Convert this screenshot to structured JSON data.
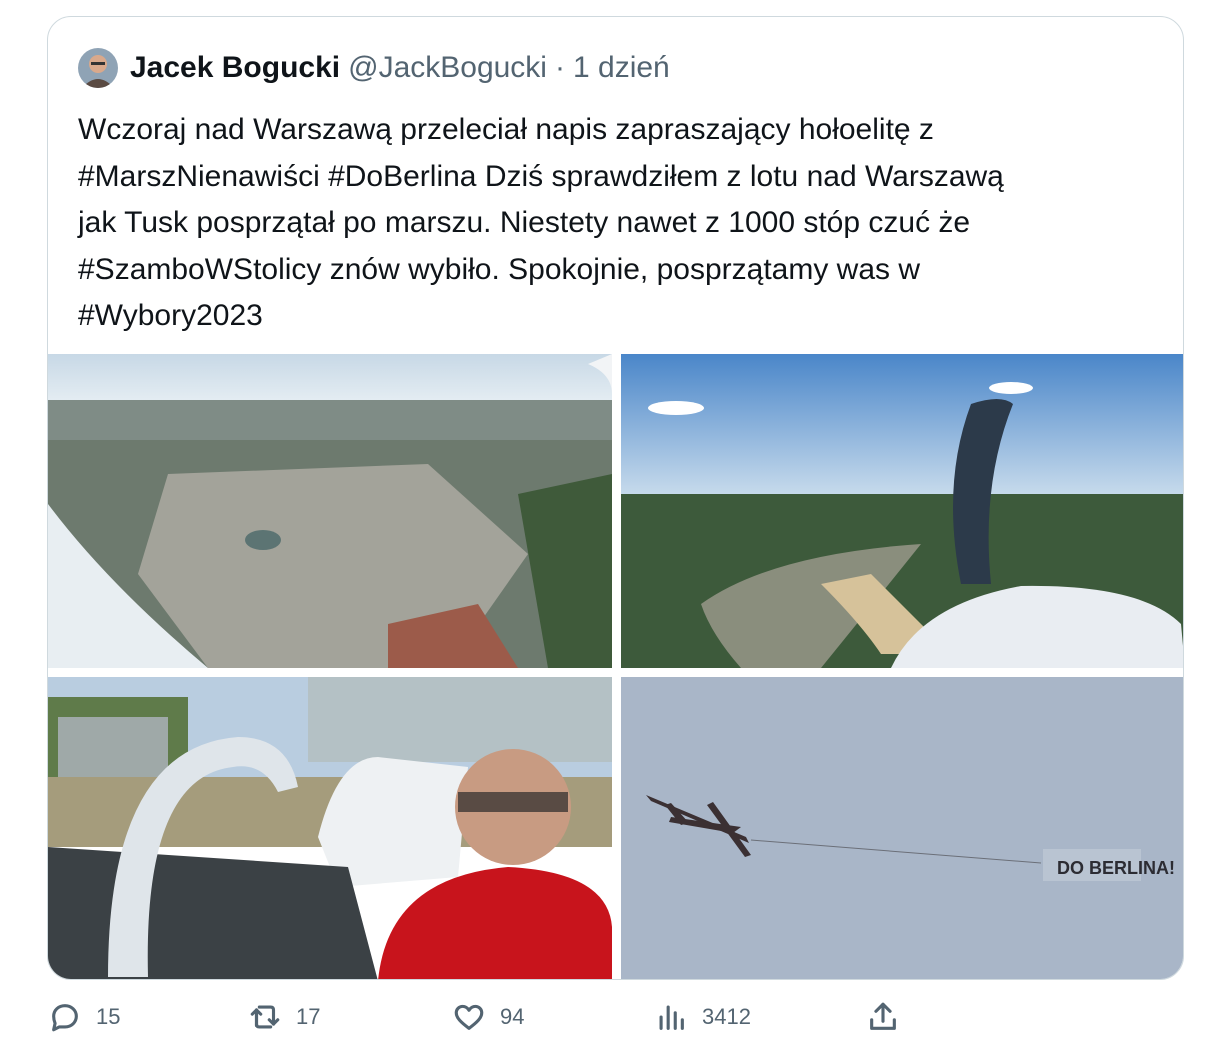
{
  "tweet": {
    "author_name": "Jacek Bogucki",
    "handle": "@JackBogucki",
    "separator": "·",
    "time": "1 dzień",
    "text": "Wczoraj nad Warszawą przeleciał napis zapraszający hołoelitę z\n#MarszNienawiści #DoBerlina Dziś sprawdziłem z lotu nad Warszawą\njak Tusk posprzątał po marszu. Niestety nawet z 1000 stóp czuć że\n#SzamboWStolicy znów wybiło. Spokojnie, posprzątamy was w\n#Wybory2023",
    "banner_text": "DO BERLINA!"
  },
  "media": [
    {
      "icon": "aerial-city-photo"
    },
    {
      "icon": "propeller-river-photo"
    },
    {
      "icon": "pilot-cockpit-selfie-photo"
    },
    {
      "icon": "plane-banner-photo"
    }
  ],
  "actions": {
    "reply_count": "15",
    "retweet_count": "17",
    "like_count": "94",
    "views_count": "3412"
  },
  "colors": {
    "text": "#0f1419",
    "secondary": "#536471",
    "border": "#cfd9de"
  }
}
